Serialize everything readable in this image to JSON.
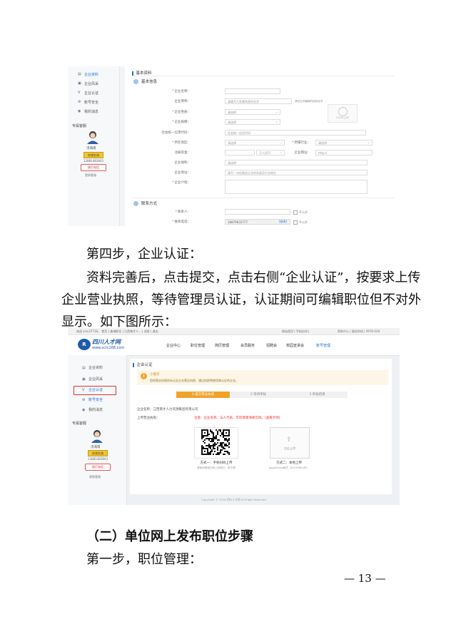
{
  "shot1": {
    "sidebar": {
      "items": [
        {
          "label": "企业资料",
          "icon": "document-icon"
        },
        {
          "label": "企业风采",
          "icon": "picture-icon"
        },
        {
          "label": "企业认证",
          "icon": "check-icon"
        },
        {
          "label": "账号安全",
          "icon": "gear-icon"
        },
        {
          "label": "我的消息",
          "icon": "eye-icon"
        }
      ],
      "service_title": "专属客服",
      "service_name": "汤海南",
      "qq_label": "在线交流",
      "phone": "13881483843",
      "dial_label": "拨打电话",
      "change_label": "更换客服"
    },
    "section_title": "基本资料",
    "basic_title": "基本信息",
    "fields": {
      "company_name": "企业名称：",
      "company_short": "企业简称：",
      "company_short_ph": "请填写大家最熟悉的名字",
      "logo_hint": "请设立好最新的招标名字",
      "logo_text": "LOGO上传",
      "nature": "企业性质：",
      "select_ph": "请选择",
      "scale": "企业规模：",
      "credit": "社会统一信用代码：",
      "credit_ph": "社会统一信用代码",
      "location": "所在地区：",
      "industry": "所属行业：",
      "capital": "注册资金：",
      "currency": "万人民币",
      "website": "企业网址：",
      "website_ph": "http://",
      "welfare": "企业福利：",
      "address": "企业地址：",
      "address_ph": "填写一句话概述企业的发展及行业地位",
      "intro": "企业介绍："
    },
    "contact_title": "联系方式",
    "contact": {
      "person": "联系人：",
      "phone": "联系电话：",
      "phone_value": "18879632777",
      "modify": "[修改]",
      "public": "不公开"
    }
  },
  "para1": {
    "line1": "第四步，企业认证：",
    "line2": "资料完善后，点击提交，点击右侧“企业认证”，按要求上传",
    "line3": "企业营业执照，等待管理员认证，认证期间可编辑职位但不对外",
    "line4": "显示。如下图所示："
  },
  "shot2": {
    "topbar": {
      "left": "欢迎 scrc37716，  首页  |  查询职位  |  江西南才人...  |  消息  |  退出",
      "mid": "网站首页  |  手机访问  |",
      "right": "帮助中心  |  服务热线  |  0978-028"
    },
    "brand": {
      "logo": "R",
      "name": "四川人才网",
      "url": "www.scrc168.com"
    },
    "nav": [
      "企业中心",
      "职位管理",
      "简历管理",
      "会员服务",
      "招聘会",
      "校园宣讲会",
      "账号管理"
    ],
    "sidebar": {
      "items": [
        {
          "label": "企业资料",
          "icon": "document-icon"
        },
        {
          "label": "企业风采",
          "icon": "picture-icon"
        },
        {
          "label": "企业认证",
          "icon": "check-icon"
        },
        {
          "label": "账号安全",
          "icon": "gear-icon"
        },
        {
          "label": "我的消息",
          "icon": "eye-icon"
        }
      ],
      "service_title": "专属客服",
      "service_name": "汤海南",
      "qq_label": "在线交流",
      "phone": "13881483843",
      "dial_label": "拨打电话",
      "change_label": "更换客服"
    },
    "section_title": "企业认证",
    "notice_title": "小提示",
    "notice_text": "您的营业执照尚未认证企业营业执照，通过执照将使用和认证的企业。",
    "steps": [
      "1 提交营业执照",
      "2 等待审核",
      "3 审核结果"
    ],
    "company": "企业名称：江西南才人力资源集团有限公司",
    "license_label": "上传营业执照：",
    "license_note": "注意：企业名称、法人代表、年检章需清晰可辨。[查看示例]",
    "upload_label": "点击上传",
    "method1": "方式一：手机扫码上传",
    "method1_sub": "请使用微信扫码上传照片，更方便",
    "method2": "方式二：本地上传",
    "method2_sub": "jpg/gif/png格式（大小5MB以内）",
    "copyright": "Copyright © 2018 四川人才网 All Right Reserved"
  },
  "para2": {
    "heading": "（二）单位网上发布职位步骤",
    "step1": "第一步，职位管理："
  },
  "page_number": "— 13 —"
}
